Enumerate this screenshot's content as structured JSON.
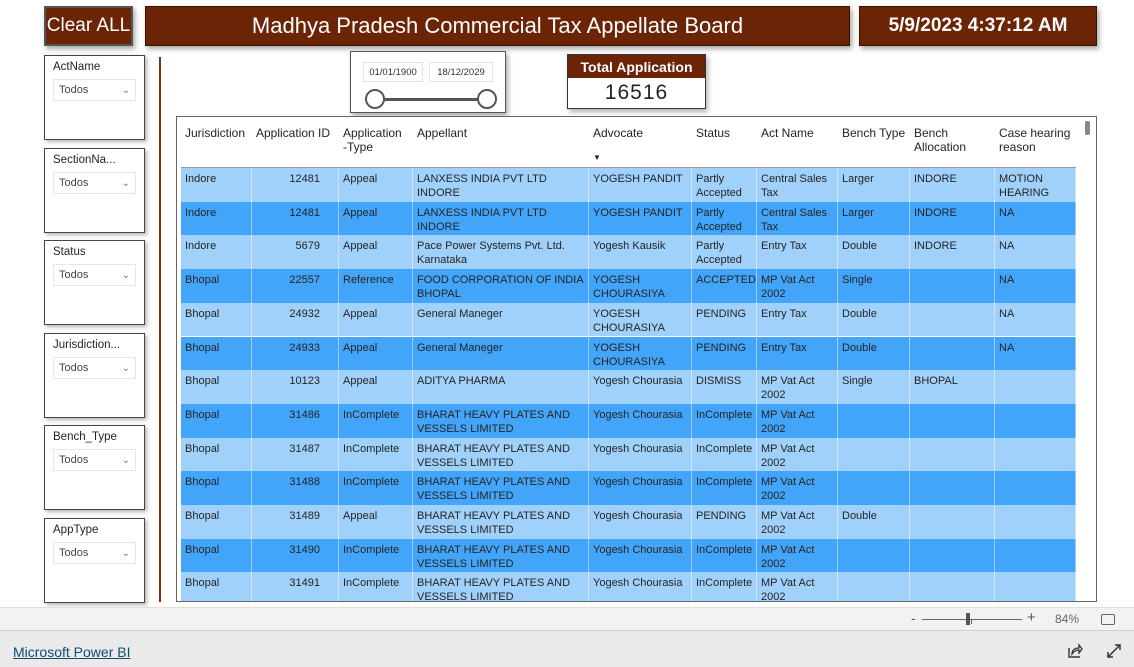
{
  "header": {
    "clear_label": "Clear ALL",
    "title": "Madhya Pradesh Commercial Tax Appellate Board",
    "datetime": "5/9/2023 4:37:12 AM"
  },
  "slicers": [
    {
      "label": "ActName",
      "value": "Todos"
    },
    {
      "label": "SectionNa...",
      "value": "Todos"
    },
    {
      "label": "Status",
      "value": "Todos"
    },
    {
      "label": "Jurisdiction...",
      "value": "Todos"
    },
    {
      "label": "Bench_Type",
      "value": "Todos"
    },
    {
      "label": "AppType",
      "value": "Todos"
    }
  ],
  "date_range": {
    "start": "01/01/1900",
    "end": "18/12/2029"
  },
  "card": {
    "title": "Total Application",
    "value": "16516"
  },
  "table": {
    "columns": [
      "Jurisdiction",
      "Application ID",
      "Application -Type",
      "Appellant",
      "Advocate",
      "Status",
      "Act Name",
      "Bench Type",
      "Bench Allocation",
      "Case hearing reason"
    ],
    "sorted_column": "Advocate",
    "row_colors": {
      "light": "#a0d1fb",
      "dark": "#42a5fa"
    },
    "rows": [
      [
        "Indore",
        "12481",
        "Appeal",
        "LANXESS INDIA PVT LTD INDORE",
        "YOGESH PANDIT",
        "Partly Accepted",
        "Central Sales Tax",
        "Larger",
        "INDORE",
        "MOTION HEARING"
      ],
      [
        "Indore",
        "12481",
        "Appeal",
        "LANXESS INDIA PVT LTD INDORE",
        "YOGESH PANDIT",
        "Partly Accepted",
        "Central Sales Tax",
        "Larger",
        "INDORE",
        "NA"
      ],
      [
        "Indore",
        "5679",
        "Appeal",
        "Pace Power Systems Pvt. Ltd. Karnataka",
        "Yogesh Kausik",
        "Partly Accepted",
        "Entry Tax",
        "Double",
        "INDORE",
        "NA"
      ],
      [
        "Bhopal",
        "22557",
        "Reference",
        "FOOD CORPORATION OF INDIA BHOPAL",
        "YOGESH CHOURASIYA",
        "ACCEPTED",
        "MP Vat Act 2002",
        "Single",
        "",
        "NA"
      ],
      [
        "Bhopal",
        "24932",
        "Appeal",
        "General Maneger",
        "YOGESH CHOURASIYA",
        "PENDING",
        "Entry Tax",
        "Double",
        "",
        "NA"
      ],
      [
        "Bhopal",
        "24933",
        "Appeal",
        "General Maneger",
        "YOGESH CHOURASIYA",
        "PENDING",
        "Entry Tax",
        "Double",
        "",
        "NA"
      ],
      [
        "Bhopal",
        "10123",
        "Appeal",
        "ADITYA PHARMA",
        "Yogesh Chourasia",
        "DISMISS",
        "MP Vat Act 2002",
        "Single",
        "BHOPAL",
        ""
      ],
      [
        "Bhopal",
        "31486",
        "InComplete",
        "BHARAT HEAVY PLATES AND VESSELS LIMITED",
        "Yogesh Chourasia",
        "InComplete",
        "MP Vat Act 2002",
        "",
        "",
        ""
      ],
      [
        "Bhopal",
        "31487",
        "InComplete",
        "BHARAT HEAVY PLATES AND VESSELS LIMITED",
        "Yogesh Chourasia",
        "InComplete",
        "MP Vat Act 2002",
        "",
        "",
        ""
      ],
      [
        "Bhopal",
        "31488",
        "InComplete",
        "BHARAT HEAVY PLATES AND VESSELS LIMITED",
        "Yogesh Chourasia",
        "InComplete",
        "MP Vat Act 2002",
        "",
        "",
        ""
      ],
      [
        "Bhopal",
        "31489",
        "Appeal",
        "BHARAT HEAVY PLATES AND VESSELS LIMITED",
        "Yogesh Chourasia",
        "PENDING",
        "MP Vat Act 2002",
        "Double",
        "",
        ""
      ],
      [
        "Bhopal",
        "31490",
        "InComplete",
        "BHARAT HEAVY PLATES AND VESSELS LIMITED",
        "Yogesh Chourasia",
        "InComplete",
        "MP Vat Act 2002",
        "",
        "",
        ""
      ],
      [
        "Bhopal",
        "31491",
        "InComplete",
        "BHARAT HEAVY PLATES AND VESSELS LIMITED",
        "Yogesh Chourasia",
        "InComplete",
        "MP Vat Act 2002",
        "",
        "",
        ""
      ]
    ]
  },
  "zoom": {
    "minus": "-",
    "plus": "+",
    "level": "84%",
    "level_percent": 84
  },
  "footer": {
    "brand_link": "Microsoft Power BI"
  }
}
